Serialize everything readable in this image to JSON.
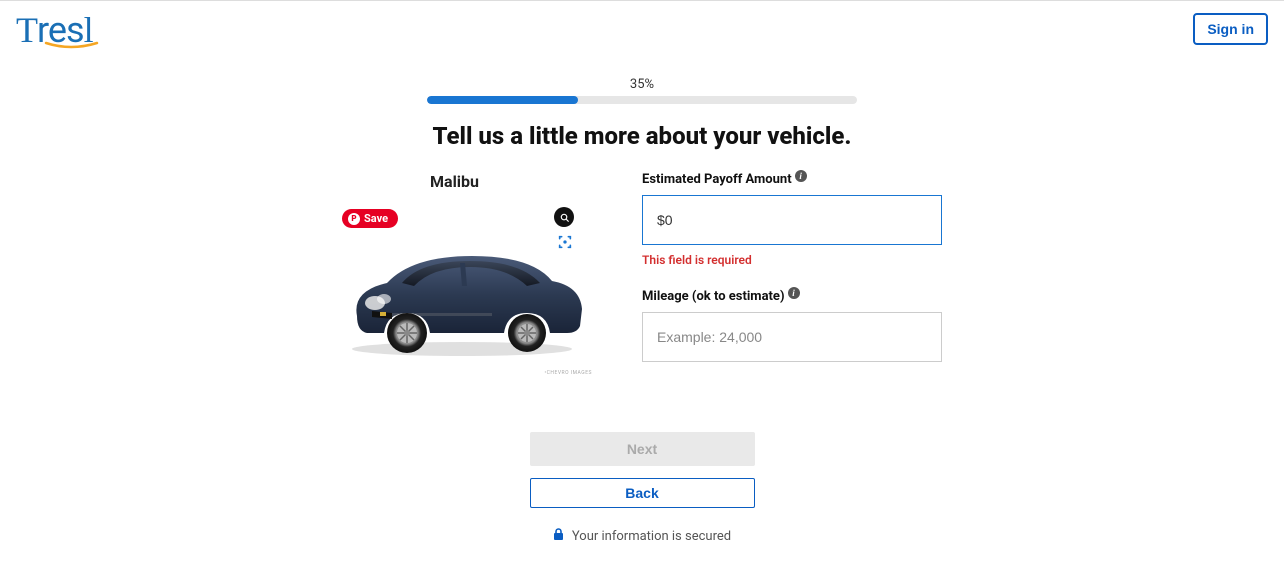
{
  "header": {
    "logo_text": "Tresl",
    "signin_label": "Sign in"
  },
  "progress": {
    "percent_label": "35%",
    "percent_value": 35
  },
  "page": {
    "heading": "Tell us a little more about your vehicle."
  },
  "vehicle": {
    "name": "Malibu",
    "save_label": "Save",
    "watermark": "•CHEVRO IMAGES"
  },
  "form": {
    "payoff": {
      "label": "Estimated Payoff Amount",
      "value": "$0",
      "error": "This field is required"
    },
    "mileage": {
      "label": "Mileage (ok to estimate)",
      "placeholder": "Example: 24,000"
    }
  },
  "nav": {
    "next_label": "Next",
    "back_label": "Back"
  },
  "footer": {
    "secure_text": "Your information is secured"
  }
}
